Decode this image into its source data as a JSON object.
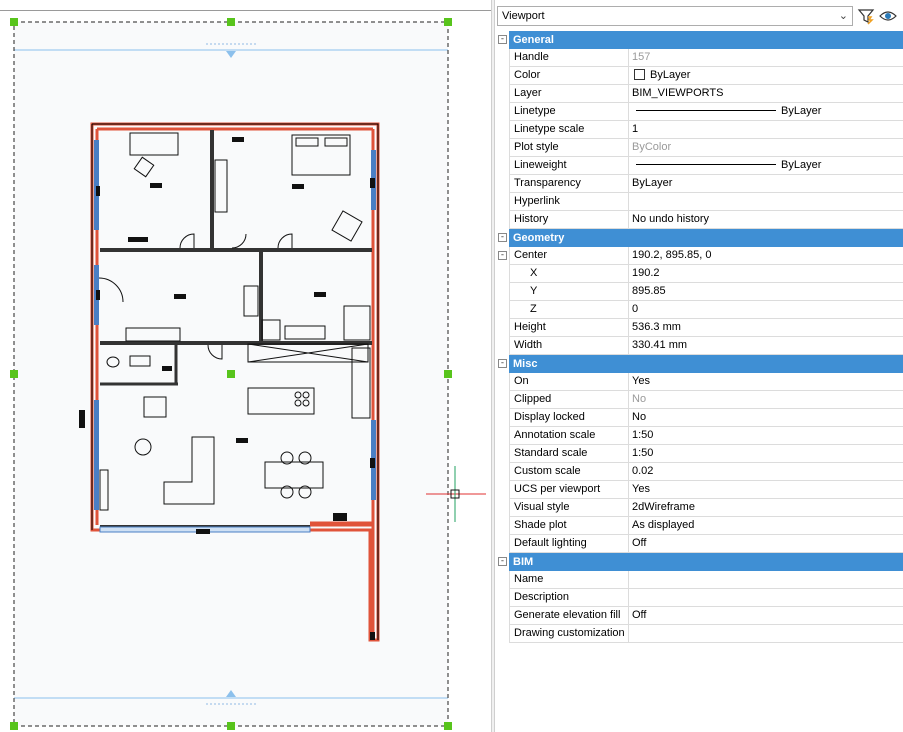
{
  "panel": {
    "selector_value": "Viewport",
    "icons": {
      "dropdown": "chevron-down-icon",
      "filter": "quick-select-filter-icon",
      "eye": "eye-icon"
    }
  },
  "categories": {
    "general": "General",
    "geometry": "Geometry",
    "misc": "Misc",
    "bim": "BIM"
  },
  "general": {
    "handle": {
      "name": "Handle",
      "value": "157"
    },
    "color": {
      "name": "Color",
      "value": "ByLayer"
    },
    "layer": {
      "name": "Layer",
      "value": "BIM_VIEWPORTS"
    },
    "linetype": {
      "name": "Linetype",
      "value": "ByLayer"
    },
    "linetype_scale": {
      "name": "Linetype scale",
      "value": "1"
    },
    "plot_style": {
      "name": "Plot style",
      "value": "ByColor"
    },
    "lineweight": {
      "name": "Lineweight",
      "value": "ByLayer"
    },
    "transparency": {
      "name": "Transparency",
      "value": "ByLayer"
    },
    "hyperlink": {
      "name": "Hyperlink",
      "value": ""
    },
    "history": {
      "name": "History",
      "value": "No undo history"
    }
  },
  "geometry": {
    "center": {
      "name": "Center",
      "value": "190.2, 895.85, 0"
    },
    "x": {
      "name": "X",
      "value": "190.2"
    },
    "y": {
      "name": "Y",
      "value": "895.85"
    },
    "z": {
      "name": "Z",
      "value": "0"
    },
    "height": {
      "name": "Height",
      "value": "536.3 mm"
    },
    "width": {
      "name": "Width",
      "value": "330.41 mm"
    }
  },
  "misc": {
    "on": {
      "name": "On",
      "value": "Yes"
    },
    "clipped": {
      "name": "Clipped",
      "value": "No"
    },
    "display_locked": {
      "name": "Display locked",
      "value": "No"
    },
    "annotation_scale": {
      "name": "Annotation scale",
      "value": "1:50"
    },
    "standard_scale": {
      "name": "Standard scale",
      "value": "1:50"
    },
    "custom_scale": {
      "name": "Custom scale",
      "value": "0.02"
    },
    "ucs_per_viewport": {
      "name": "UCS per viewport",
      "value": "Yes"
    },
    "visual_style": {
      "name": "Visual style",
      "value": "2dWireframe"
    },
    "shade_plot": {
      "name": "Shade plot",
      "value": "As displayed"
    },
    "default_lighting": {
      "name": "Default lighting",
      "value": "Off"
    }
  },
  "bim": {
    "name": {
      "name": "Name",
      "value": ""
    },
    "description": {
      "name": "Description",
      "value": ""
    },
    "generate_elevation_fill": {
      "name": "Generate elevation fill",
      "value": "Off"
    },
    "drawing_customization": {
      "name": "Drawing customization",
      "value": ""
    }
  },
  "colors": {
    "category_band": "#3f8fd4",
    "grip": "#58c41c",
    "wall_fill": "#e0533a",
    "window": "#4a7fc4",
    "viewport_guide": "#8cc0ec",
    "cursor_red": "#e03030",
    "cursor_green": "#20a060"
  }
}
